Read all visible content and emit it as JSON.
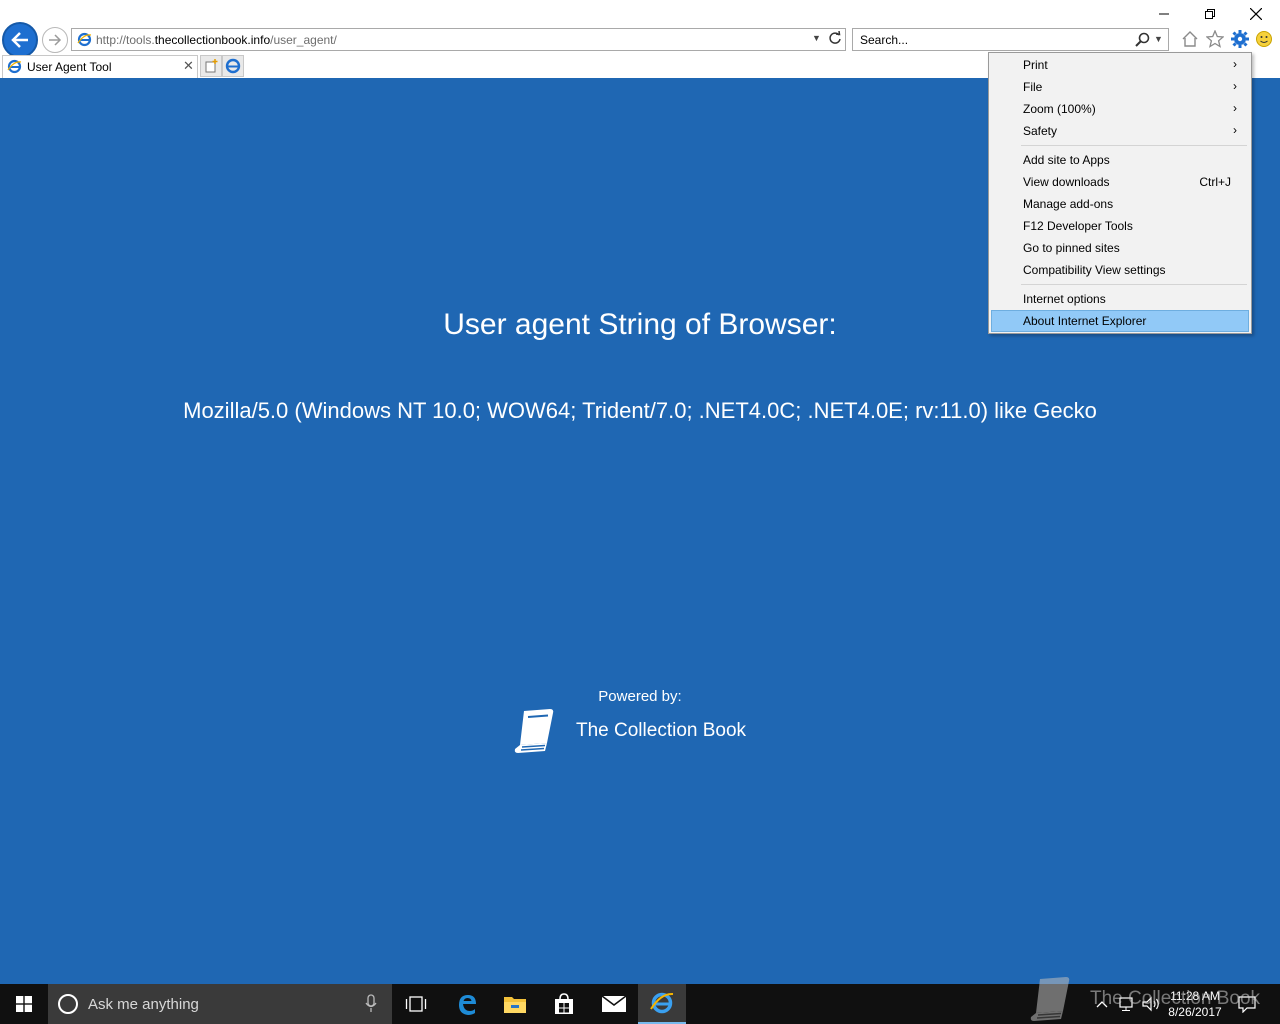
{
  "browser": {
    "url_prefix": "http://tools.",
    "url_domain": "thecollectionbook.info",
    "url_path": "/user_agent/",
    "search_placeholder": "Search...",
    "tab_title": "User Agent Tool",
    "accent": "#1e6fd0"
  },
  "page": {
    "heading": "User agent String of Browser:",
    "user_agent": "Mozilla/5.0 (Windows NT 10.0; WOW64; Trident/7.0; .NET4.0C; .NET4.0E; rv:11.0) like Gecko",
    "powered_by": "Powered by:",
    "brand": "The Collection Book",
    "background": "#1f67b3"
  },
  "tools_menu": {
    "items": [
      {
        "label": "Print",
        "submenu": true
      },
      {
        "label": "File",
        "submenu": true
      },
      {
        "label": "Zoom (100%)",
        "submenu": true
      },
      {
        "label": "Safety",
        "submenu": true
      },
      {
        "label": "Add site to Apps"
      },
      {
        "label": "View downloads",
        "shortcut": "Ctrl+J"
      },
      {
        "label": "Manage add-ons"
      },
      {
        "label": "F12 Developer Tools"
      },
      {
        "label": "Go to pinned sites"
      },
      {
        "label": "Compatibility View settings"
      },
      {
        "label": "Internet options"
      },
      {
        "label": "About Internet Explorer",
        "highlighted": true
      }
    ],
    "arrow": "›"
  },
  "taskbar": {
    "search_placeholder": "Ask me anything",
    "time": "11:28 AM",
    "date": "8/26/2017"
  },
  "watermark": {
    "text": "The Collection Book"
  }
}
